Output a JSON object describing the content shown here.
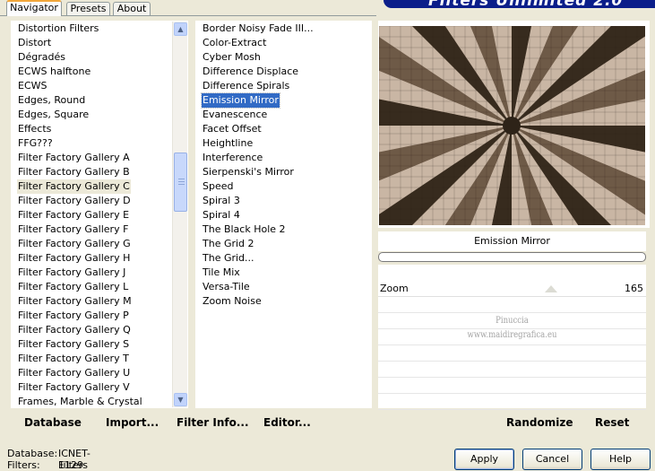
{
  "tabs": [
    "Navigator",
    "Presets",
    "About"
  ],
  "banner_title": "Filters Unlimited 2.0",
  "categories": {
    "items": [
      "Distortion Filters",
      "Distort",
      "Dégradés",
      "ECWS halftone",
      "ECWS",
      "Edges, Round",
      "Edges, Square",
      "Effects",
      "FFG???",
      "Filter Factory Gallery A",
      "Filter Factory Gallery B",
      "Filter Factory Gallery C",
      "Filter Factory Gallery D",
      "Filter Factory Gallery E",
      "Filter Factory Gallery F",
      "Filter Factory Gallery G",
      "Filter Factory Gallery H",
      "Filter Factory Gallery J",
      "Filter Factory Gallery L",
      "Filter Factory Gallery M",
      "Filter Factory Gallery P",
      "Filter Factory Gallery Q",
      "Filter Factory Gallery S",
      "Filter Factory Gallery T",
      "Filter Factory Gallery U",
      "Filter Factory Gallery V",
      "Frames, Marble & Crystal"
    ],
    "selected": "Filter Factory Gallery C"
  },
  "filters": {
    "items": [
      "Border Noisy Fade III...",
      "Color-Extract",
      "Cyber Mosh",
      "Difference Displace",
      "Difference Spirals",
      "Emission Mirror",
      "Evanescence",
      "Facet Offset",
      "Heightline",
      "Interference",
      "Sierpenski's Mirror",
      "Speed",
      "Spiral 3",
      "Spiral 4",
      "The Black Hole 2",
      "The Grid 2",
      "The Grid...",
      "Tile Mix",
      "Versa-Tile",
      "Zoom Noise"
    ],
    "selected": "Emission Mirror"
  },
  "preview": {
    "filter_name": "Emission Mirror",
    "colors": {
      "dark": "#2e2318",
      "mid": "#6e5a48",
      "light": "#d9c7b5"
    }
  },
  "controls": {
    "slider": {
      "label": "Zoom",
      "value": "165",
      "level": 165,
      "max": 255
    },
    "watermark": [
      "Pinuccia",
      "www.maidiregrafica.eu"
    ]
  },
  "left_actions": {
    "database": "Database",
    "import": "Import...",
    "filter_info": "Filter Info...",
    "editor": "Editor..."
  },
  "right_actions": {
    "randomize": "Randomize",
    "reset": "Reset"
  },
  "status": {
    "database_label": "Database:",
    "database_value": "ICNET-Filters",
    "filters_label": "Filters:",
    "filters_value": "1129"
  },
  "buttons": {
    "apply": "Apply",
    "cancel": "Cancel",
    "help": "Help"
  },
  "accent_colors": {
    "selection": "#316ac5",
    "banner": "#0b1e8a",
    "dialog": "#ece9d8"
  }
}
